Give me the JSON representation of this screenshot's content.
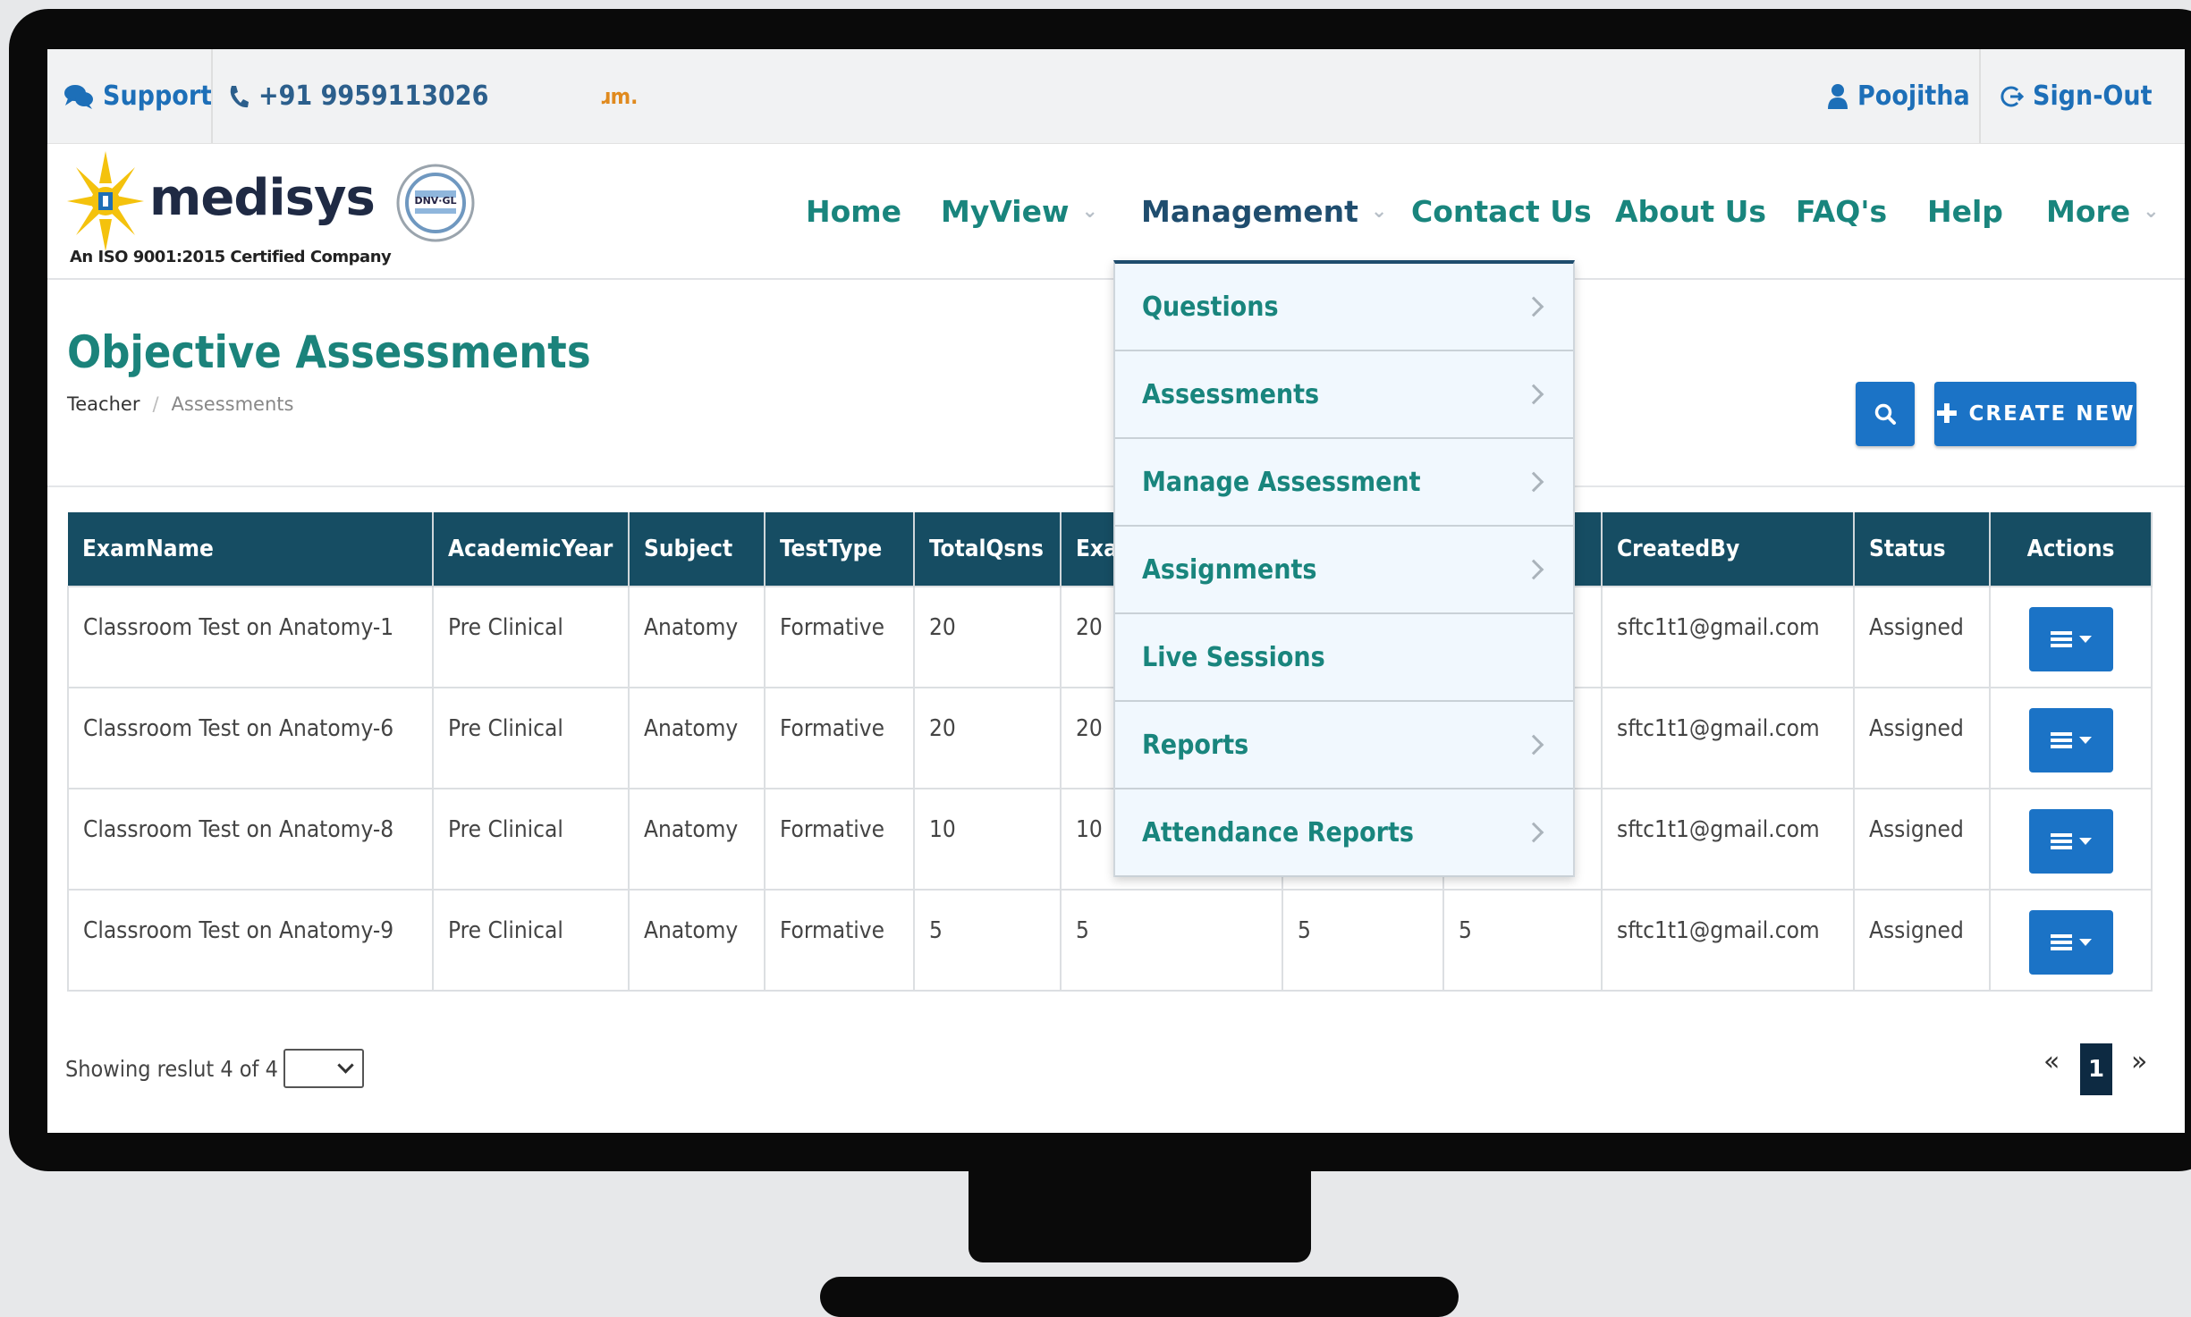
{
  "topbar": {
    "support_label": "Support",
    "phone": "+91 9959113026",
    "marquee": "ɹm.",
    "user": "Poojitha",
    "signout_label": "Sign-Out"
  },
  "header": {
    "logo_name": "medisys",
    "logo_tagline": "An ISO 9001:2015 Certified Company",
    "cert_badge": "DNV·GL",
    "nav": [
      "Home",
      "MyView",
      "Management",
      "Contact Us",
      "About Us",
      "FAQ's",
      "Help",
      "More"
    ]
  },
  "management_menu": [
    {
      "label": "Questions",
      "has_submenu": true
    },
    {
      "label": "Assessments",
      "has_submenu": true
    },
    {
      "label": "Manage Assessment",
      "has_submenu": true
    },
    {
      "label": "Assignments",
      "has_submenu": true
    },
    {
      "label": "Live Sessions",
      "has_submenu": false
    },
    {
      "label": "Reports",
      "has_submenu": true
    },
    {
      "label": "Attendance Reports",
      "has_submenu": true
    }
  ],
  "page": {
    "title": "Objective Assessments",
    "breadcrumb": [
      "Teacher",
      "Assessments"
    ],
    "create_label": "CREATE NEW"
  },
  "table": {
    "columns": [
      "ExamName",
      "AcademicYear",
      "Subject",
      "TestType",
      "TotalQsns",
      "Exa",
      "",
      "",
      "CreatedBy",
      "Status",
      "Actions"
    ],
    "rows": [
      [
        "Classroom Test on Anatomy-1",
        "Pre Clinical",
        "Anatomy",
        "Formative",
        "20",
        "20",
        "",
        "",
        "sftc1t1@gmail.com",
        "Assigned"
      ],
      [
        "Classroom Test on Anatomy-6",
        "Pre Clinical",
        "Anatomy",
        "Formative",
        "20",
        "20",
        "",
        "",
        "sftc1t1@gmail.com",
        "Assigned"
      ],
      [
        "Classroom Test on Anatomy-8",
        "Pre Clinical",
        "Anatomy",
        "Formative",
        "10",
        "10",
        "",
        "",
        "sftc1t1@gmail.com",
        "Assigned"
      ],
      [
        "Classroom Test on Anatomy-9",
        "Pre Clinical",
        "Anatomy",
        "Formative",
        "5",
        "5",
        "5",
        "5",
        "sftc1t1@gmail.com",
        "Assigned"
      ]
    ]
  },
  "footer": {
    "showing_text": "Showing reslut 4 of 4",
    "page_prev": "«",
    "page_current": "1",
    "page_next": "»"
  },
  "colors": {
    "accent": "#1b73c6",
    "nav_teal": "#19857d",
    "table_header": "#164d63",
    "title_teal": "#1b837b"
  }
}
